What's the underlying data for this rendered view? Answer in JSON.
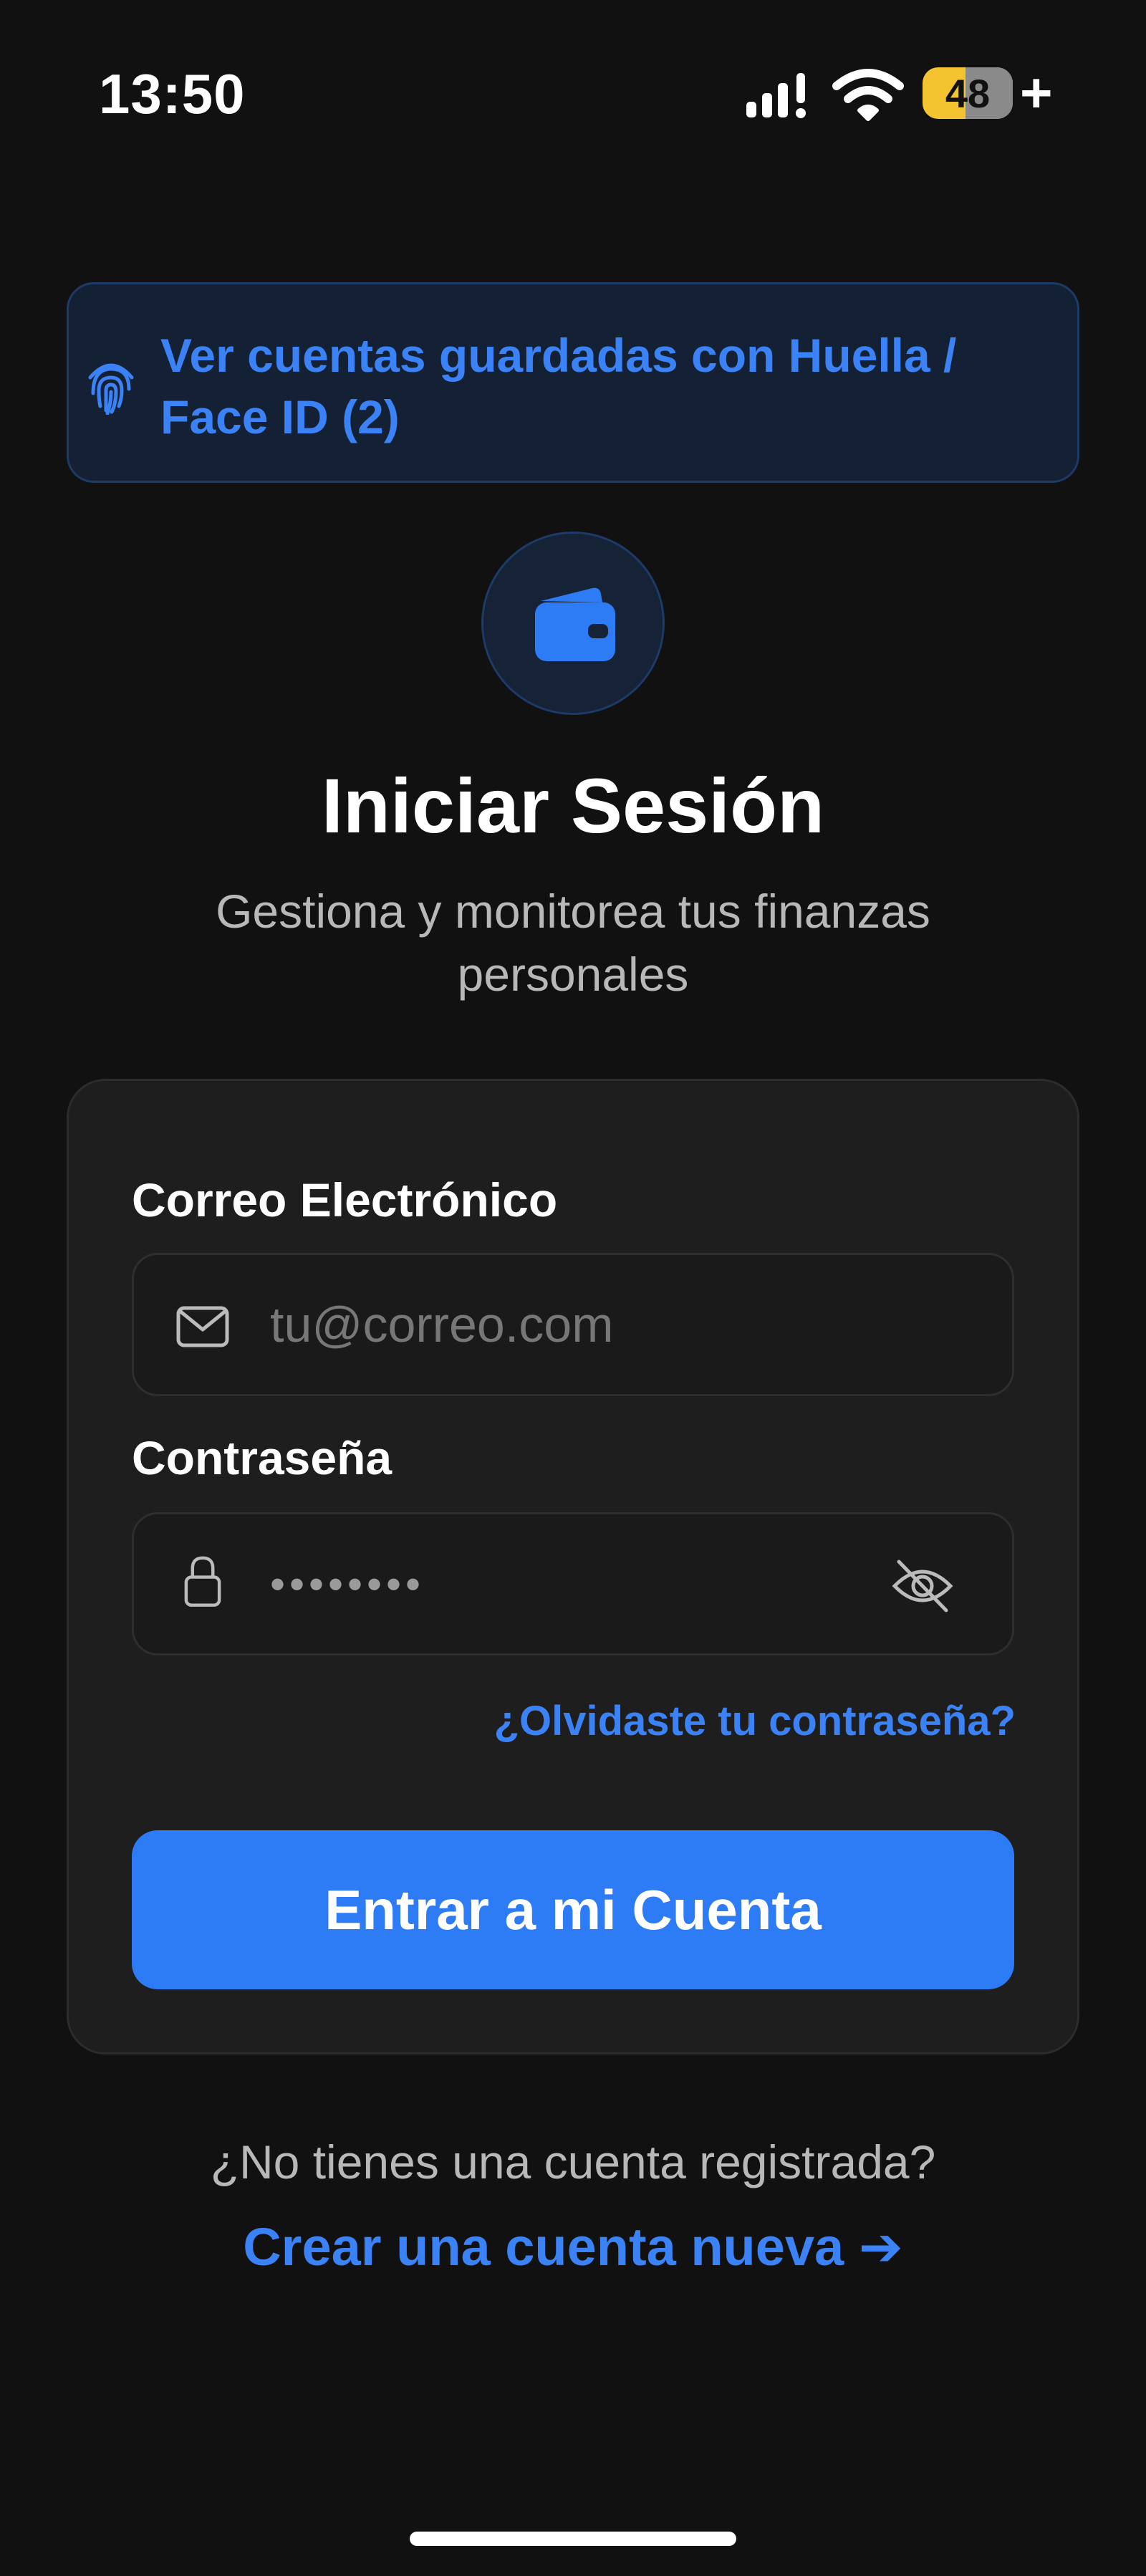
{
  "status_bar": {
    "time": "13:50",
    "battery_level": "48",
    "battery_percent": 48,
    "charging_symbol": "+",
    "icons": [
      "cellular-signal-icon",
      "wifi-icon",
      "battery-icon"
    ]
  },
  "saved_accounts": {
    "label": "Ver cuentas guardadas con Huella / Face ID (2)",
    "icon": "fingerprint-icon"
  },
  "logo": {
    "icon": "wallet-icon"
  },
  "header": {
    "title": "Iniciar Sesión",
    "subtitle": "Gestiona y monitorea tus finanzas personales"
  },
  "form": {
    "email": {
      "label": "Correo Electrónico",
      "placeholder": "tu@correo.com",
      "value": "",
      "icon": "mail-icon"
    },
    "password": {
      "label": "Contraseña",
      "value": "••••••••",
      "icon": "lock-icon",
      "toggle_icon": "eye-off-icon"
    },
    "forgot_password": "¿Olvidaste tu contraseña?",
    "submit_label": "Entrar a mi Cuenta"
  },
  "register": {
    "question": "¿No tienes una cuenta registrada?",
    "link_label": "Crear una cuenta nueva ➔"
  },
  "colors": {
    "background": "#111111",
    "card": "#1e1e1e",
    "accent": "#3b82f6",
    "button": "#2d7cf6",
    "muted_text": "#b8b8b8",
    "battery": "#f4c430"
  }
}
